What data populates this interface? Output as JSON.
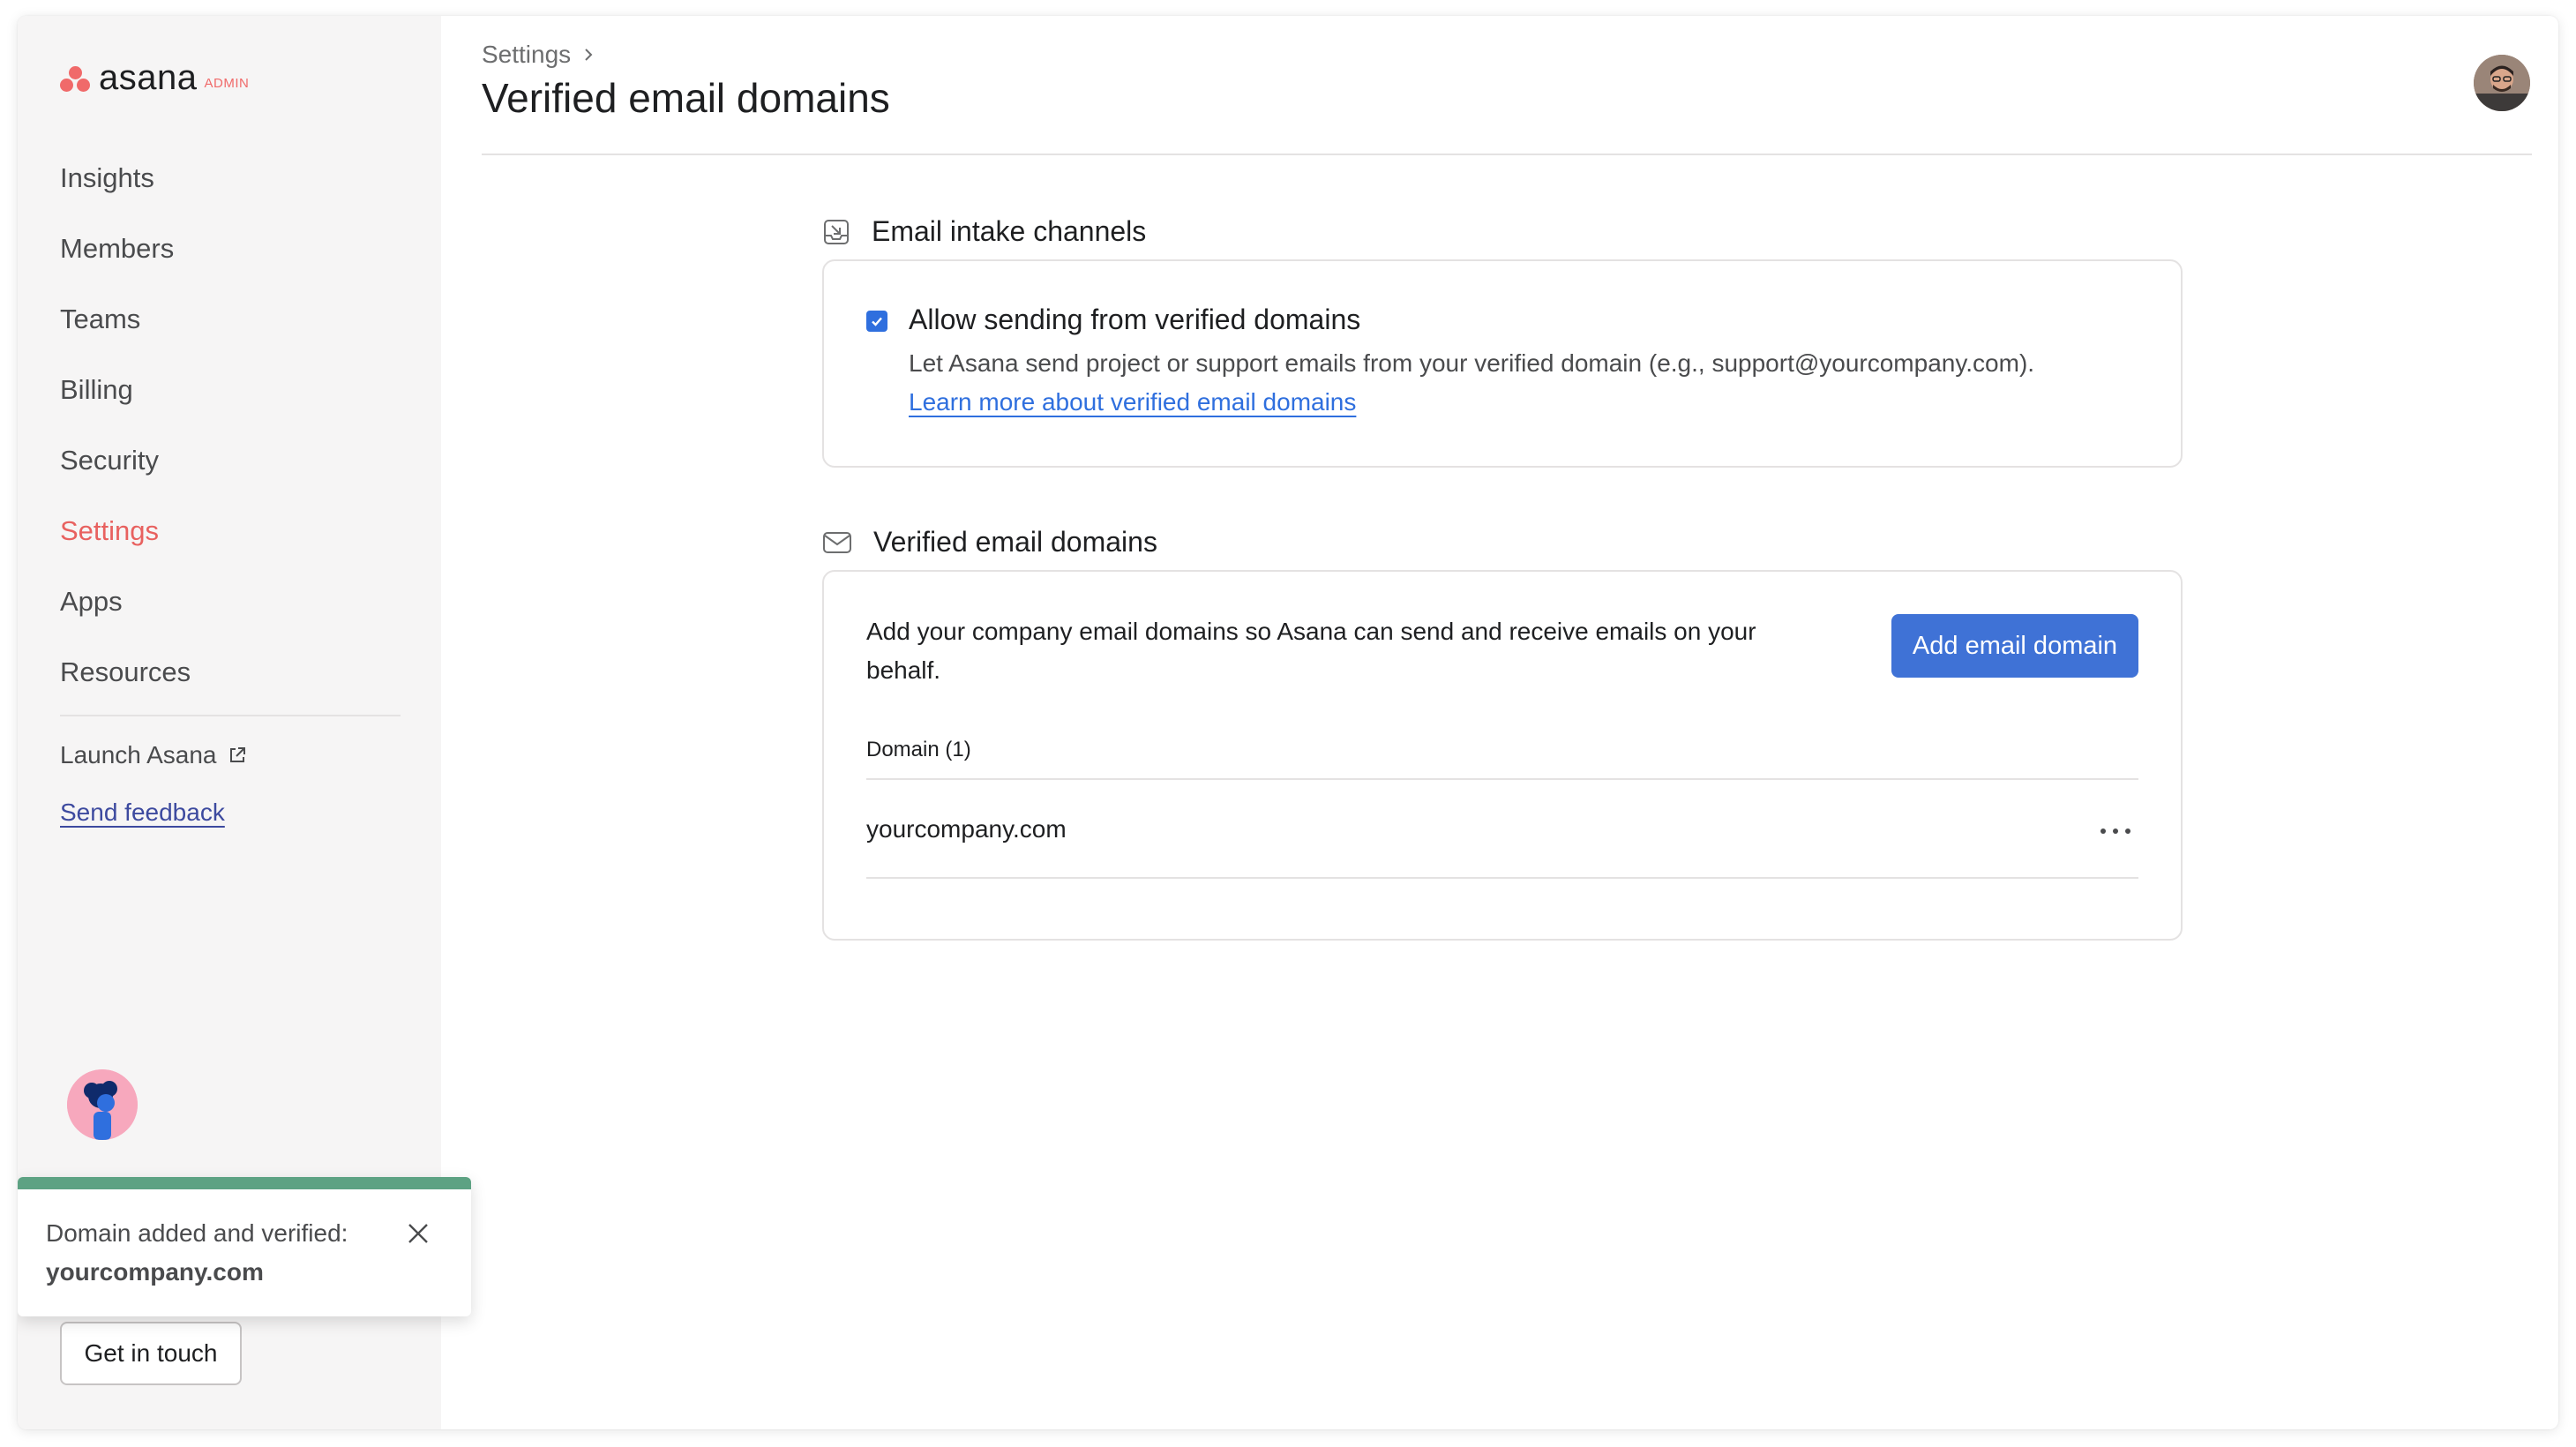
{
  "brand": {
    "name": "asana",
    "badge": "ADMIN",
    "accent": "#f06a6a"
  },
  "sidebar": {
    "items": [
      {
        "label": "Insights",
        "active": false
      },
      {
        "label": "Members",
        "active": false
      },
      {
        "label": "Teams",
        "active": false
      },
      {
        "label": "Billing",
        "active": false
      },
      {
        "label": "Security",
        "active": false
      },
      {
        "label": "Settings",
        "active": true
      },
      {
        "label": "Apps",
        "active": false
      },
      {
        "label": "Resources",
        "active": false
      }
    ],
    "launch_label": "Launch Asana",
    "launch_icon": "external-link-icon",
    "feedback_label": "Send feedback",
    "get_in_touch_label": "Get in touch"
  },
  "header": {
    "breadcrumb": "Settings",
    "title": "Verified email domains"
  },
  "intake": {
    "heading": "Email intake channels",
    "icon": "inbox-arrow-icon",
    "option": {
      "checked": true,
      "title": "Allow sending from verified domains",
      "description": "Let Asana send project or support emails from your verified domain (e.g., support@yourcompany.com).",
      "link": "Learn more about verified email domains"
    }
  },
  "domains": {
    "heading": "Verified email domains",
    "icon": "envelope-icon",
    "description": "Add your company email domains so Asana can send and receive emails on your behalf.",
    "add_button": "Add email domain",
    "column_header": "Domain (1)",
    "rows": [
      {
        "domain": "yourcompany.com"
      }
    ]
  },
  "toast": {
    "message": "Domain added and verified:",
    "domain": "yourcompany.com",
    "status_color": "#5da283"
  }
}
